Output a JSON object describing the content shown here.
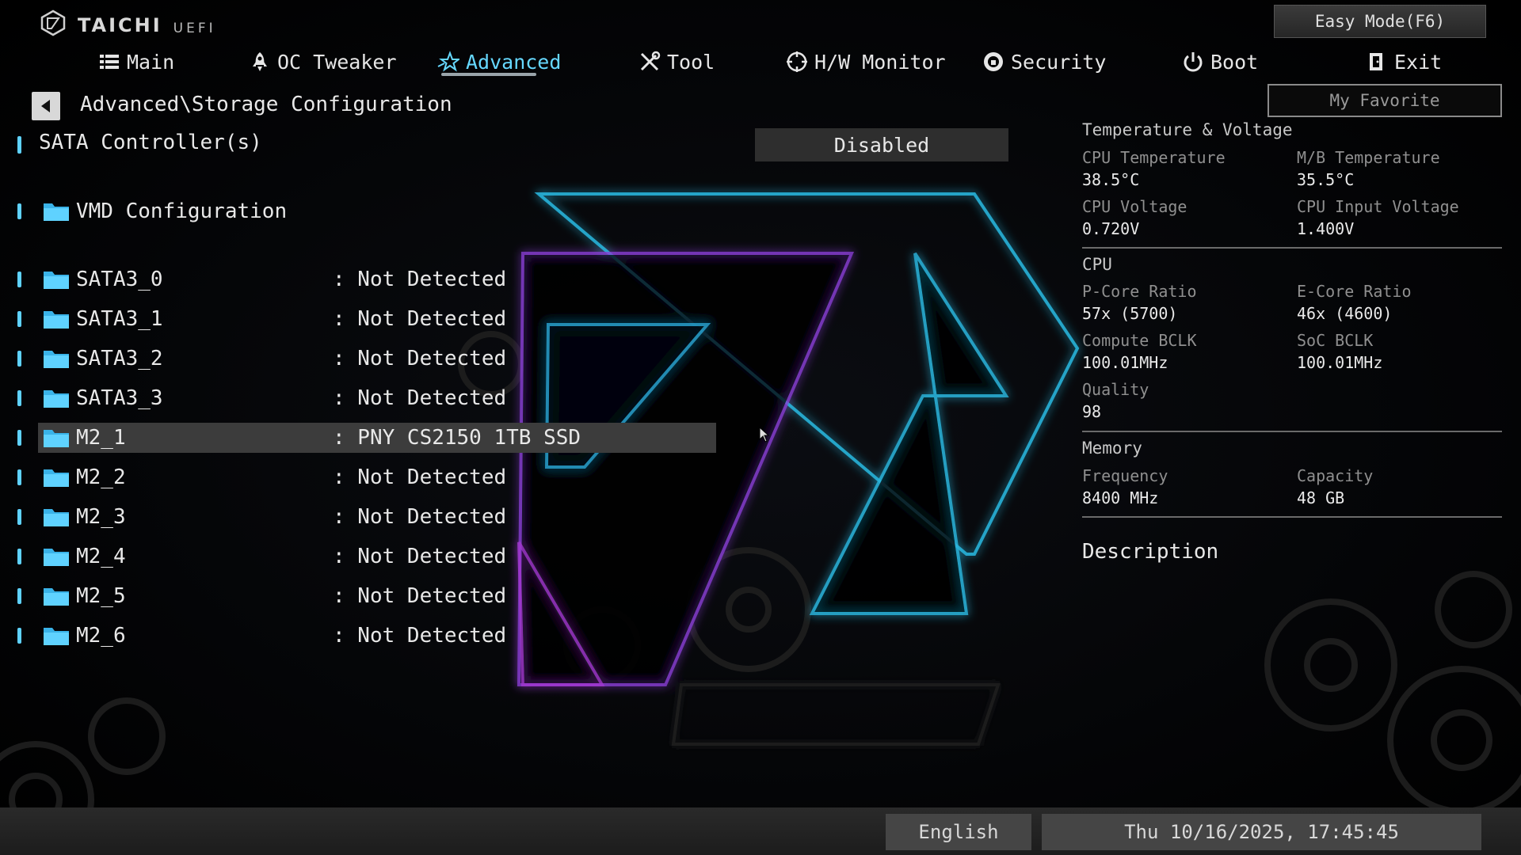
{
  "brand": {
    "name": "TAICHI",
    "sub": "UEFI"
  },
  "easy_mode_label": "Easy Mode(F6)",
  "my_favorite_label": "My Favorite",
  "tabs": [
    {
      "id": "main",
      "label": "Main",
      "icon": "list-icon"
    },
    {
      "id": "oc",
      "label": "OC Tweaker",
      "icon": "rocket-icon"
    },
    {
      "id": "advanced",
      "label": "Advanced",
      "icon": "star-icon",
      "active": true
    },
    {
      "id": "tool",
      "label": "Tool",
      "icon": "tools-icon"
    },
    {
      "id": "hwmon",
      "label": "H/W Monitor",
      "icon": "monitor-icon"
    },
    {
      "id": "security",
      "label": "Security",
      "icon": "shield-icon"
    },
    {
      "id": "boot",
      "label": "Boot",
      "icon": "power-icon"
    },
    {
      "id": "exit",
      "label": "Exit",
      "icon": "exit-door-icon"
    }
  ],
  "breadcrumb": "Advanced\\Storage Configuration",
  "sata_controllers": {
    "label": "SATA Controller(s)",
    "value": "Disabled"
  },
  "vmd_config": {
    "label": "VMD Configuration"
  },
  "drives": [
    {
      "label": "SATA3_0",
      "value": ": Not Detected"
    },
    {
      "label": "SATA3_1",
      "value": ": Not Detected"
    },
    {
      "label": "SATA3_2",
      "value": ": Not Detected"
    },
    {
      "label": "SATA3_3",
      "value": ": Not Detected"
    },
    {
      "label": "M2_1",
      "value": ": PNY CS2150 1TB SSD",
      "selected": true
    },
    {
      "label": "M2_2",
      "value": ": Not Detected"
    },
    {
      "label": "M2_3",
      "value": ": Not Detected"
    },
    {
      "label": "M2_4",
      "value": ": Not Detected"
    },
    {
      "label": "M2_5",
      "value": ": Not Detected"
    },
    {
      "label": "M2_6",
      "value": ": Not Detected"
    }
  ],
  "panel": {
    "temp_voltage": {
      "title": "Temperature & Voltage",
      "cpu_temp": {
        "label": "CPU Temperature",
        "value": "38.5°C"
      },
      "mb_temp": {
        "label": "M/B Temperature",
        "value": "35.5°C"
      },
      "cpu_voltage": {
        "label": "CPU Voltage",
        "value": "0.720V"
      },
      "cpu_input_voltage": {
        "label": "CPU Input Voltage",
        "value": "1.400V"
      }
    },
    "cpu": {
      "title": "CPU",
      "pcore": {
        "label": "P-Core Ratio",
        "value": "57x (5700)"
      },
      "ecore": {
        "label": "E-Core Ratio",
        "value": "46x (4600)"
      },
      "compute_bclk": {
        "label": "Compute BCLK",
        "value": "100.01MHz"
      },
      "soc_bclk": {
        "label": "SoC BCLK",
        "value": "100.01MHz"
      },
      "quality": {
        "label": "Quality",
        "value": "98"
      }
    },
    "memory": {
      "title": "Memory",
      "frequency": {
        "label": "Frequency",
        "value": "8400 MHz"
      },
      "capacity": {
        "label": "Capacity",
        "value": "48 GB"
      }
    },
    "description_title": "Description"
  },
  "footer": {
    "language": "English",
    "datetime": "Thu 10/16/2025, 17:45:45"
  },
  "colors": {
    "accent": "#5fd2ff",
    "selected_row": "#3c3c3c",
    "background": "#000000"
  }
}
